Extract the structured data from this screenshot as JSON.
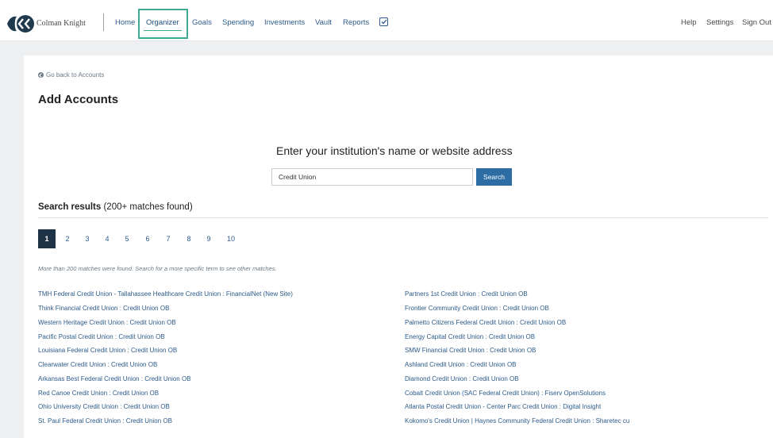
{
  "header": {
    "brand": "Colman Knight",
    "nav": [
      {
        "label": "Home"
      },
      {
        "label": "Organizer",
        "active": true
      },
      {
        "label": "Goals"
      },
      {
        "label": "Spending"
      },
      {
        "label": "Investments"
      },
      {
        "label": "Vault"
      },
      {
        "label": "Reports"
      }
    ],
    "right_nav": [
      {
        "label": "Help"
      },
      {
        "label": "Settings"
      },
      {
        "label": "Sign Out"
      }
    ],
    "accent_color": "#3fa890"
  },
  "page": {
    "back_link": "Go back to Accounts",
    "title": "Add Accounts"
  },
  "search": {
    "prompt": "Enter your institution's name or website address",
    "value": "Credit Union",
    "button_label": "Search",
    "button_color": "#2e6da4"
  },
  "results": {
    "heading_bold": "Search results",
    "heading_count": "(200+ matches found)",
    "pages": [
      "1",
      "2",
      "3",
      "4",
      "5",
      "6",
      "7",
      "8",
      "9",
      "10"
    ],
    "current_page": "1",
    "note": "More than 200 matches were found. Search for a more specific term to see other matches.",
    "left": [
      "TMH Federal Credit Union - Tallahassee Healthcare Credit Union : FinancialNet (New Site)",
      "Think Financial Credit Union : Credit Union OB",
      "Western Heritage Credit Union : Credit Union OB",
      "Pacific Postal Credit Union : Credit Union OB",
      "Louisiana Federal Credit Union : Credit Union OB",
      "Clearwater Credit Union : Credit Union OB",
      "Arkansas Best Federal Credit Union : Credit Union OB",
      "Red Canoe Credit Union : Credit Union OB",
      "Ohio University Credit Union : Credit Union OB",
      "St. Paul Federal Credit Union : Credit Union OB"
    ],
    "right": [
      "Partners 1st Credit Union : Credit Union OB",
      "Frontier Community Credit Union : Credit Union OB",
      "Palmetto Citizens Federal Credit Union : Credit Union OB",
      "Energy Capital Credit Union : Credit Union OB",
      "SMW Financial Credit Union : Credit Union OB",
      "Ashland Credit Union : Credit Union OB",
      "Diamond Credit Union : Credit Union OB",
      "Cobalt Credit Union (SAC Federal Credit Union) : Fiserv OpenSolutions",
      "Atlanta Postal Credit Union - Center Parc Credit Union : Digital Insight",
      "Kokomo's Credit Union | Haynes Community Federal Credit Union : Sharetec cu"
    ]
  }
}
